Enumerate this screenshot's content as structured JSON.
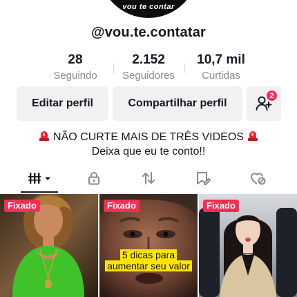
{
  "profile": {
    "avatar_text": "vou te contar",
    "username": "@vou.te.contatar"
  },
  "stats": [
    {
      "value": "28",
      "label": "Seguindo"
    },
    {
      "value": "2.152",
      "label": "Seguidores"
    },
    {
      "value": "10,7 mil",
      "label": "Curtidas"
    }
  ],
  "actions": {
    "edit_label": "Editar perfil",
    "share_label": "Compartilhar perfil",
    "friend_requests": "2"
  },
  "bio": {
    "line1": "NÃO CURTE MAIS DE TRÊS VIDEOS",
    "line2": "Deixa que eu te conto!!",
    "emoji": "police-light-icon"
  },
  "tabs": [
    {
      "icon": "grid-icon",
      "selected": true
    },
    {
      "icon": "lock-icon",
      "selected": false
    },
    {
      "icon": "repost-icon",
      "selected": false
    },
    {
      "icon": "saved-icon",
      "selected": false
    },
    {
      "icon": "liked-icon",
      "selected": false
    }
  ],
  "videos": [
    {
      "pinned_label": "Fixado",
      "caption": ""
    },
    {
      "pinned_label": "Fixado",
      "caption": "5 dicas para aumentar seu valor"
    },
    {
      "pinned_label": "Fixado",
      "caption": ""
    }
  ],
  "colors": {
    "accent": "#fe2c55",
    "text": "#161823",
    "muted": "#8a8b91",
    "button_bg": "#f1f1f2"
  }
}
